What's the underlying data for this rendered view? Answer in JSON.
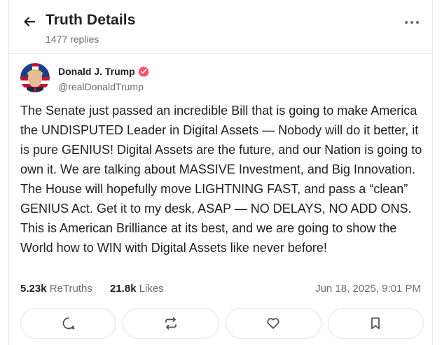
{
  "header": {
    "title": "Truth Details",
    "subtitle": "1477 replies"
  },
  "author": {
    "name": "Donald J. Trump",
    "handle": "@realDonaldTrump",
    "verified": true,
    "verified_color": "#ff4f6d"
  },
  "post": {
    "text": "The Senate just passed an incredible Bill that is going to make America the UNDISPUTED Leader in Digital Assets — Nobody will do it better, it is pure GENIUS! Digital Assets are the future, and our Nation is going to own it. We are talking about MASSIVE Investment, and Big Innovation. The House will hopefully move LIGHTNING FAST, and pass a “clean” GENIUS Act. Get it to my desk, ASAP — NO DELAYS, NO ADD ONS. This is American Brilliance at its best, and we are going to show the World how to WIN with Digital Assets like never before!"
  },
  "stats": {
    "retruths_count": "5.23k",
    "retruths_label": "ReTruths",
    "likes_count": "21.8k",
    "likes_label": "Likes",
    "timestamp": "Jun 18, 2025, 9:01 PM"
  },
  "actions": [
    {
      "name": "reply",
      "icon": "chat-bubble-icon"
    },
    {
      "name": "retruth",
      "icon": "repost-icon"
    },
    {
      "name": "like",
      "icon": "heart-icon"
    },
    {
      "name": "bookmark",
      "icon": "bookmark-icon"
    }
  ],
  "colors": {
    "text": "#1f1f24",
    "muted": "#6b6b76",
    "border": "#e3e3e7"
  }
}
